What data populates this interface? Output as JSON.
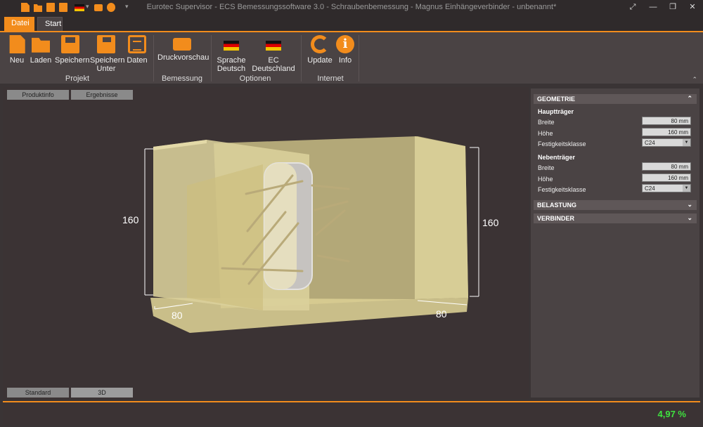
{
  "window": {
    "title": "Eurotec Supervisor - ECS Bemessungssoftware 3.0 - Schraubenbemessung - Magnus Einhängeverbinder - unbenannt*",
    "controls": [
      "⤢",
      "—",
      "❐",
      "✕"
    ]
  },
  "tabs": {
    "file": "Datei",
    "start": "Start"
  },
  "ribbon": {
    "groups": {
      "projekt": "Projekt",
      "bemessung": "Bemessung",
      "optionen": "Optionen",
      "internet": "Internet"
    },
    "buttons": {
      "new": "Neu",
      "load": "Laden",
      "save": "Speichern",
      "save_as_1": "Speichern",
      "save_as_2": "Unter",
      "data": "Daten",
      "print_preview": "Druckvorschau",
      "language_1": "Sprache",
      "language_2": "Deutsch",
      "ec_1": "EC",
      "ec_2": "Deutschland",
      "update": "Update",
      "info": "Info"
    },
    "icons": [
      "doc-icon",
      "folder-icon",
      "save-icon",
      "save-as-icon",
      "data-icon",
      "printer-icon",
      "german-flag-icon",
      "refresh-icon",
      "info-icon"
    ],
    "accent": "#f28c1c"
  },
  "viewer": {
    "top_tabs": {
      "product_info": "Produktinfo",
      "results": "Ergebnisse"
    },
    "bottom_tabs": {
      "standard": "Standard",
      "view_3d": "3D"
    },
    "dimensions": {
      "main_height": "160",
      "secondary_height": "160",
      "main_width": "80",
      "secondary_width": "80"
    }
  },
  "panel": {
    "geometry": {
      "title": "GEOMETRIE",
      "main_beam": {
        "title": "Hauptträger",
        "width_label": "Breite",
        "width_value": "80 mm",
        "height_label": "Höhe",
        "height_value": "160 mm",
        "strength_label": "Festigkeitsklasse",
        "strength_value": "C24"
      },
      "secondary_beam": {
        "title": "Nebenträger",
        "width_label": "Breite",
        "width_value": "80 mm",
        "height_label": "Höhe",
        "height_value": "160 mm",
        "strength_label": "Festigkeitsklasse",
        "strength_value": "C24"
      }
    },
    "load": {
      "title": "BELASTUNG"
    },
    "connector": {
      "title": "VERBINDER"
    }
  },
  "status": {
    "utilization": "4,97 %",
    "utilization_color": "#3fe23f"
  }
}
